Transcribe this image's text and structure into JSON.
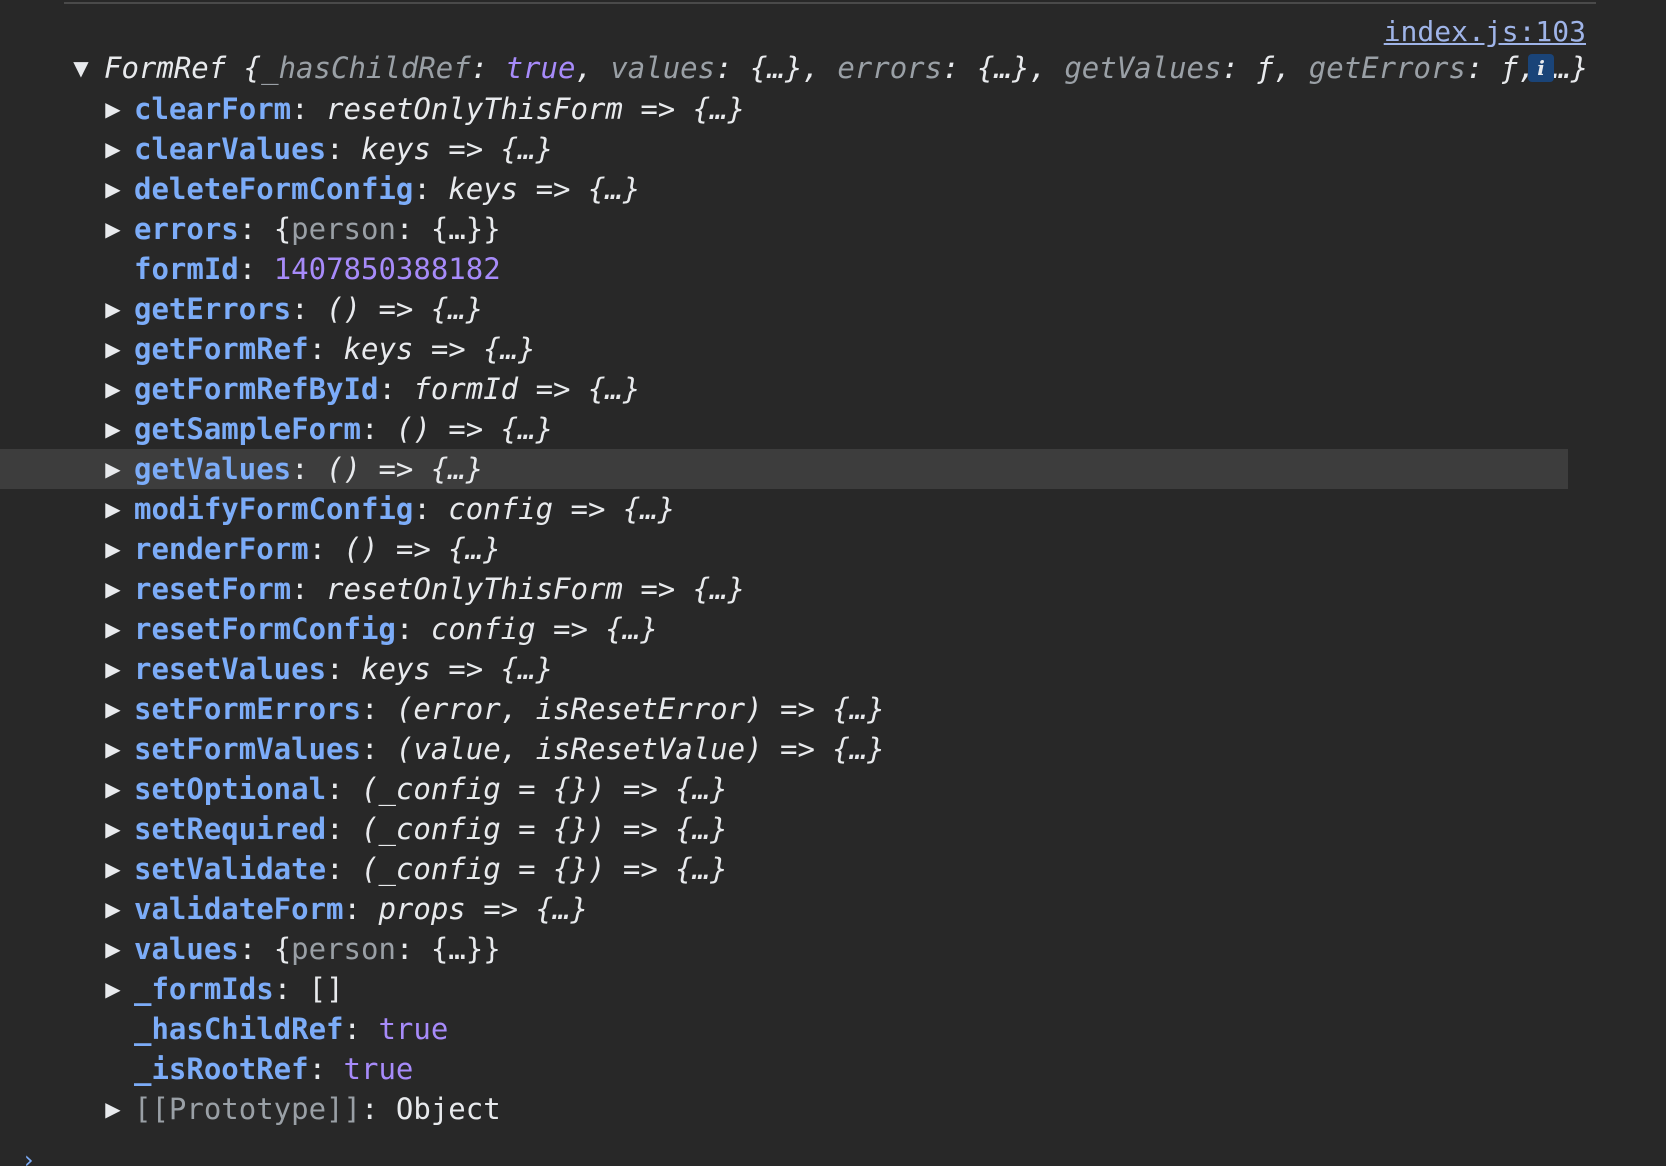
{
  "source_link": "index.js:103",
  "summary": {
    "name": "FormRef",
    "open": " {",
    "k1": "_hasChildRef",
    "s1": ": ",
    "v1": "true",
    "s1b": ", ",
    "k2": "values",
    "s2": ": ",
    "v2": "{…}",
    "s2b": ", ",
    "k3": "errors",
    "s3": ": ",
    "v3": "{…}",
    "s3b": ", ",
    "k4": "getValues",
    "s4": ": ",
    "v4": "ƒ",
    "s4b": ", ",
    "k5": "getErrors",
    "s5": ": ",
    "v5": "ƒ",
    "tail": ", …}",
    "info_icon": "i"
  },
  "props": [
    {
      "key": "clearForm",
      "sep": ": ",
      "sig": "resetOnlyThisForm => {…}"
    },
    {
      "key": "clearValues",
      "sep": ": ",
      "sig": "keys => {…}"
    },
    {
      "key": "deleteFormConfig",
      "sep": ": ",
      "sig": "keys => {…}"
    },
    {
      "key": "errors",
      "sep": ": ",
      "open": "{",
      "k": "person",
      "ksep": ": ",
      "v": "{…}",
      "close": "}"
    },
    {
      "key": "formId",
      "sep": ": ",
      "num": "1407850388182"
    },
    {
      "key": "getErrors",
      "sep": ": ",
      "sig": "() => {…}"
    },
    {
      "key": "getFormRef",
      "sep": ": ",
      "sig": "keys => {…}"
    },
    {
      "key": "getFormRefById",
      "sep": ": ",
      "sig": "formId => {…}"
    },
    {
      "key": "getSampleForm",
      "sep": ": ",
      "sig": "() => {…}"
    },
    {
      "key": "getValues",
      "sep": ": ",
      "sig": "() => {…}"
    },
    {
      "key": "modifyFormConfig",
      "sep": ": ",
      "sig": "config => {…}"
    },
    {
      "key": "renderForm",
      "sep": ": ",
      "sig": "() => {…}"
    },
    {
      "key": "resetForm",
      "sep": ": ",
      "sig": "resetOnlyThisForm => {…}"
    },
    {
      "key": "resetFormConfig",
      "sep": ": ",
      "sig": "config => {…}"
    },
    {
      "key": "resetValues",
      "sep": ": ",
      "sig": "keys => {…}"
    },
    {
      "key": "setFormErrors",
      "sep": ": ",
      "sig": "(error, isResetError) => {…}"
    },
    {
      "key": "setFormValues",
      "sep": ": ",
      "sig": "(value, isResetValue) => {…}"
    },
    {
      "key": "setOptional",
      "sep": ": ",
      "sig": "(_config = {}) => {…}"
    },
    {
      "key": "setRequired",
      "sep": ": ",
      "sig": "(_config = {}) => {…}"
    },
    {
      "key": "setValidate",
      "sep": ": ",
      "sig": "(_config = {}) => {…}"
    },
    {
      "key": "validateForm",
      "sep": ": ",
      "sig": "props => {…}"
    },
    {
      "key": "values",
      "sep": ": ",
      "open": "{",
      "k": "person",
      "ksep": ": ",
      "v": "{…}",
      "close": "}"
    },
    {
      "key": "_formIds",
      "sep": ": ",
      "plain": "[]"
    },
    {
      "key": "_hasChildRef",
      "sep": ": ",
      "kw": "true"
    },
    {
      "key": "_isRootRef",
      "sep": ": ",
      "kw": "true"
    },
    {
      "key": "[[Prototype]]",
      "sep": ": ",
      "plain": "Object"
    }
  ],
  "expand_arrow": "▶",
  "collapse_arrow": "▼",
  "prompt_caret": "›",
  "colors": {
    "background": "#282828",
    "property_key": "#7cacf8",
    "keyword_value": "#a78bfa",
    "dim_text": "#9aa0a6",
    "link": "#9fb4e8",
    "highlight_row": "#3d3d3d",
    "info_badge": "#1a4478"
  }
}
